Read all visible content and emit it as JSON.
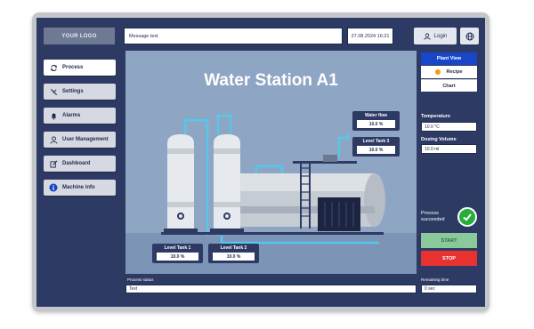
{
  "header": {
    "logo": "YOUR LOGO",
    "message": "Message text",
    "datetime": "27.08.2024 16:21",
    "login_label": "Login"
  },
  "sidebar": {
    "items": [
      {
        "label": "Process",
        "icon": "refresh-icon"
      },
      {
        "label": "Settings",
        "icon": "tools-icon"
      },
      {
        "label": "Alarms",
        "icon": "bell-icon"
      },
      {
        "label": "User Management",
        "icon": "user-icon"
      },
      {
        "label": "Dashboard",
        "icon": "edit-icon"
      },
      {
        "label": "Machine info",
        "icon": "info-icon"
      }
    ]
  },
  "scene": {
    "title": "Water Station A1",
    "tags": {
      "water_flow": {
        "label": "Water flow",
        "value": "10.0 %"
      },
      "level_tank_3": {
        "label": "Level Tank 3",
        "value": "10.0 %"
      },
      "level_tank_1": {
        "label": "Level Tank 1",
        "value": "10.0 %"
      },
      "level_tank_2": {
        "label": "Level Tank 2",
        "value": "10.0 %"
      }
    }
  },
  "right_panel": {
    "tabs": [
      "Plant View",
      "Recipe",
      "Chart"
    ],
    "temperature_label": "Temperature",
    "temperature_value": "10.0 °C",
    "dosing_label": "Dosing Volume",
    "dosing_value": "10.0 ml",
    "process_status_text": "Process\nsucceeded",
    "start_label": "START",
    "stop_label": "STOP"
  },
  "footer": {
    "process_status_label": "Process status",
    "process_status_value": "Text",
    "remaining_label": "Remaining time",
    "remaining_value": "0 sec"
  },
  "colors": {
    "screen_bg": "#2d3a63",
    "scene_bg": "#8ea5c3",
    "accent_blue": "#1746c9",
    "success": "#27ae3a",
    "stop": "#e8322f",
    "start": "#8bc99a",
    "recipe_dot": "#f39c12"
  }
}
